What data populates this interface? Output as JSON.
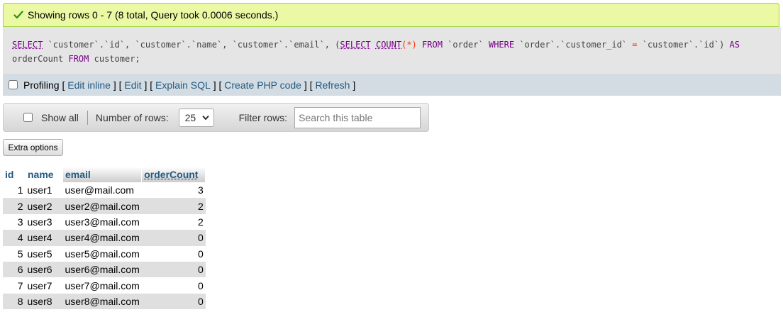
{
  "status": {
    "message": "Showing rows 0 - 7 (8 total, Query took 0.0006 seconds.)",
    "icon": "checkmark-icon",
    "color": "#ebf8a4"
  },
  "sql": {
    "tokens": [
      {
        "t": "SELECT",
        "c": "kw"
      },
      {
        "t": " `customer`.`id`, `customer`.`name`, `customer`.`email`, (",
        "c": "bt"
      },
      {
        "t": "SELECT",
        "c": "kw"
      },
      {
        "t": " ",
        "c": "bt"
      },
      {
        "t": "COUNT",
        "c": "kw"
      },
      {
        "t": "(*)",
        "c": "op"
      },
      {
        "t": " ",
        "c": "bt"
      },
      {
        "t": "FROM",
        "c": "kw2"
      },
      {
        "t": " `order` ",
        "c": "bt"
      },
      {
        "t": "WHERE",
        "c": "kw2"
      },
      {
        "t": " `order`.`customer_id` ",
        "c": "bt"
      },
      {
        "t": "=",
        "c": "op"
      },
      {
        "t": " `customer`.`id`) ",
        "c": "bt"
      },
      {
        "t": "AS",
        "c": "kw2"
      },
      {
        "t": "\norderCount ",
        "c": "bt"
      },
      {
        "t": "FROM",
        "c": "kw2"
      },
      {
        "t": " customer;",
        "c": "bt"
      }
    ]
  },
  "profiling": {
    "label": "Profiling",
    "links": [
      "Edit inline",
      "Edit",
      "Explain SQL",
      "Create PHP code",
      "Refresh"
    ]
  },
  "nav": {
    "show_all": "Show all",
    "rows_label": "Number of rows:",
    "rows_value": "25",
    "filter_label": "Filter rows:",
    "filter_placeholder": "Search this table"
  },
  "extra_options": "Extra options",
  "table": {
    "columns": [
      "id",
      "name",
      "email",
      "orderCount"
    ],
    "rows": [
      [
        "1",
        "user1",
        "user@mail.com",
        "3"
      ],
      [
        "2",
        "user2",
        "user2@mail.com",
        "2"
      ],
      [
        "3",
        "user3",
        "user3@mail.com",
        "2"
      ],
      [
        "4",
        "user4",
        "user4@mail.com",
        "0"
      ],
      [
        "5",
        "user5",
        "user5@mail.com",
        "0"
      ],
      [
        "6",
        "user6",
        "user6@mail.com",
        "0"
      ],
      [
        "7",
        "user7",
        "user7@mail.com",
        "0"
      ],
      [
        "8",
        "user8",
        "user8@mail.com",
        "0"
      ]
    ]
  }
}
